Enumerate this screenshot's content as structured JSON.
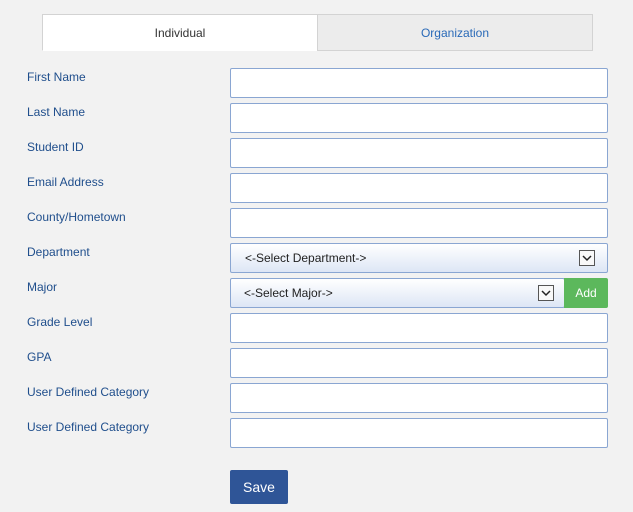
{
  "tabs": [
    {
      "label": "Individual",
      "active": true
    },
    {
      "label": "Organization",
      "active": false
    }
  ],
  "fields": {
    "first_name": {
      "label": "First Name",
      "value": ""
    },
    "last_name": {
      "label": "Last Name",
      "value": ""
    },
    "student_id": {
      "label": "Student ID",
      "value": ""
    },
    "email": {
      "label": "Email Address",
      "value": ""
    },
    "county": {
      "label": "County/Hometown",
      "value": ""
    },
    "department": {
      "label": "Department",
      "selected": "<-Select Department->"
    },
    "major": {
      "label": "Major",
      "selected": "<-Select Major->",
      "add_label": "Add"
    },
    "grade_level": {
      "label": "Grade Level",
      "value": ""
    },
    "gpa": {
      "label": "GPA",
      "value": ""
    },
    "user_cat_1": {
      "label": "User Defined Category",
      "value": ""
    },
    "user_cat_2": {
      "label": "User Defined Category",
      "value": ""
    }
  },
  "save_label": "Save",
  "colors": {
    "label": "#1f4e8c",
    "tab_inactive_text": "#2a6ab8",
    "add_button": "#5cb85c",
    "save_button": "#2f5597",
    "input_border": "#8aa6d2"
  }
}
